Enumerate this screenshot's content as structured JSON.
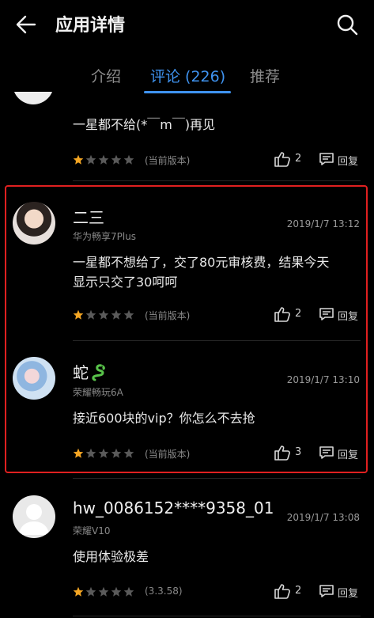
{
  "header": {
    "title": "应用详情"
  },
  "tabs": [
    {
      "label": "介绍"
    },
    {
      "label": "评论 (226)"
    },
    {
      "label": "推荐"
    }
  ],
  "comments": [
    {
      "text": "一星都不给(*￣m￣)再见",
      "version": "(当前版本)",
      "rating": 1,
      "likes": "2",
      "reply": "回复"
    },
    {
      "user": "二三",
      "device": "华为畅享7Plus",
      "date": "2019/1/7 13:12",
      "text_lines": [
        "一星都不想给了，交了80元审核费，结果今天",
        "显示只交了30呵呵"
      ],
      "version": "(当前版本)",
      "rating": 1,
      "likes": "2",
      "reply": "回复"
    },
    {
      "user": "蛇",
      "device": "荣耀畅玩6A",
      "date": "2019/1/7 13:10",
      "text": "接近600块的vip？你怎么不去抢",
      "version": "(当前版本)",
      "rating": 1,
      "likes": "3",
      "reply": "回复"
    },
    {
      "user": "hw_0086152****9358_01",
      "device": "荣耀V10",
      "date": "2019/1/7 13:08",
      "text": "使用体验极差",
      "version": "(3.3.58)",
      "rating": 1,
      "likes": "2",
      "reply": "回复"
    }
  ],
  "colors": {
    "accent": "#3f93f0",
    "star_filled": "#f5a623",
    "star_empty": "#5a5a5a",
    "highlight_border": "#e02020"
  }
}
